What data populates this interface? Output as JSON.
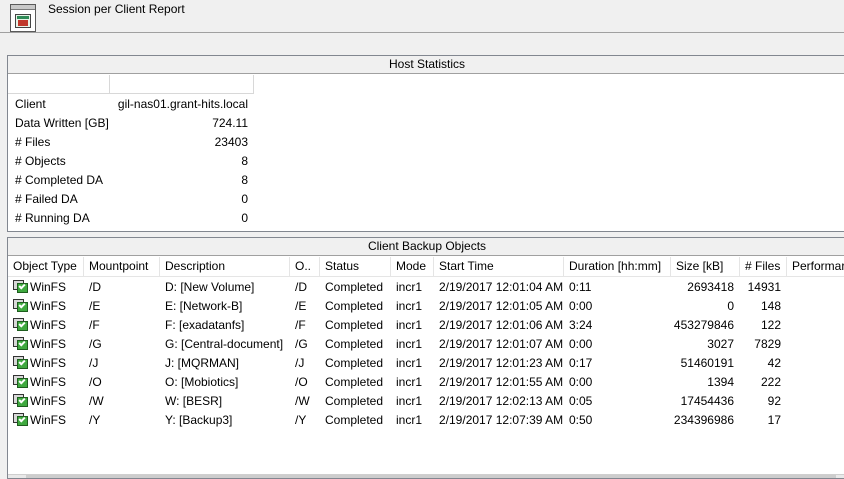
{
  "header": {
    "title": "Session per Client Report",
    "icon": "report-icon"
  },
  "host_statistics": {
    "title": "Host Statistics",
    "rows": [
      {
        "label": "Client",
        "value": "gil-nas01.grant-hits.local"
      },
      {
        "label": "Data Written [GB]",
        "value": "724.11"
      },
      {
        "label": "# Files",
        "value": "23403"
      },
      {
        "label": "# Objects",
        "value": "8"
      },
      {
        "label": "# Completed DA",
        "value": "8"
      },
      {
        "label": "# Failed DA",
        "value": "0"
      },
      {
        "label": "# Running DA",
        "value": "0"
      }
    ]
  },
  "client_backup_objects": {
    "title": "Client Backup Objects",
    "columns": [
      "Object Type",
      "Mountpoint",
      "Description",
      "O..",
      "Status",
      "Mode",
      "Start Time",
      "Duration [hh:mm]",
      "Size [kB]",
      "# Files",
      "Performar"
    ],
    "rows": [
      {
        "type": "WinFS",
        "mountpoint": "/D",
        "description": "D: [New Volume]",
        "o": "/D",
        "status": "Completed",
        "mode": "incr1",
        "start": "2/19/2017 12:01:04 AM",
        "duration": "0:11",
        "size": "2693418",
        "files": "14931"
      },
      {
        "type": "WinFS",
        "mountpoint": "/E",
        "description": "E: [Network-B]",
        "o": "/E",
        "status": "Completed",
        "mode": "incr1",
        "start": "2/19/2017 12:01:05 AM",
        "duration": "0:00",
        "size": "0",
        "files": "148"
      },
      {
        "type": "WinFS",
        "mountpoint": "/F",
        "description": "F: [exadatanfs]",
        "o": "/F",
        "status": "Completed",
        "mode": "incr1",
        "start": "2/19/2017 12:01:06 AM",
        "duration": "3:24",
        "size": "453279846",
        "files": "122"
      },
      {
        "type": "WinFS",
        "mountpoint": "/G",
        "description": "G: [Central-document]",
        "o": "/G",
        "status": "Completed",
        "mode": "incr1",
        "start": "2/19/2017 12:01:07 AM",
        "duration": "0:00",
        "size": "3027",
        "files": "7829"
      },
      {
        "type": "WinFS",
        "mountpoint": "/J",
        "description": "J: [MQRMAN]",
        "o": "/J",
        "status": "Completed",
        "mode": "incr1",
        "start": "2/19/2017 12:01:23 AM",
        "duration": "0:17",
        "size": "51460191",
        "files": "42"
      },
      {
        "type": "WinFS",
        "mountpoint": "/O",
        "description": "O: [Mobiotics]",
        "o": "/O",
        "status": "Completed",
        "mode": "incr1",
        "start": "2/19/2017 12:01:55 AM",
        "duration": "0:00",
        "size": "1394",
        "files": "222"
      },
      {
        "type": "WinFS",
        "mountpoint": "/W",
        "description": "W: [BESR]",
        "o": "/W",
        "status": "Completed",
        "mode": "incr1",
        "start": "2/19/2017 12:02:13 AM",
        "duration": "0:05",
        "size": "17454436",
        "files": "92"
      },
      {
        "type": "WinFS",
        "mountpoint": "/Y",
        "description": "Y: [Backup3]",
        "o": "/Y",
        "status": "Completed",
        "mode": "incr1",
        "start": "2/19/2017 12:07:39 AM",
        "duration": "0:50",
        "size": "234396986",
        "files": "17"
      }
    ]
  }
}
